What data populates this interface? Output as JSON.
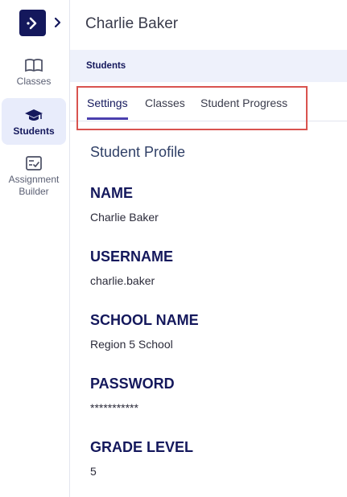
{
  "sidebar": {
    "items": [
      {
        "label": "Classes",
        "icon": "book-open-icon"
      },
      {
        "label": "Students",
        "icon": "graduation-cap-icon",
        "active": true
      },
      {
        "label": "Assignment Builder",
        "icon": "checklist-icon"
      }
    ]
  },
  "header": {
    "title": "Charlie Baker"
  },
  "breadcrumb": {
    "current": "Students"
  },
  "tabs": [
    {
      "label": "Settings",
      "active": true
    },
    {
      "label": "Classes"
    },
    {
      "label": "Student Progress"
    }
  ],
  "profile": {
    "section_title": "Student Profile",
    "fields": [
      {
        "label": "NAME",
        "value": "Charlie Baker"
      },
      {
        "label": "USERNAME",
        "value": "charlie.baker"
      },
      {
        "label": "SCHOOL NAME",
        "value": "Region 5 School"
      },
      {
        "label": "PASSWORD",
        "value": "***********"
      },
      {
        "label": "GRADE LEVEL",
        "value": "5"
      }
    ]
  },
  "colors": {
    "brand": "#14185c",
    "accent": "#4a3fae",
    "highlight": "#d9534f"
  }
}
